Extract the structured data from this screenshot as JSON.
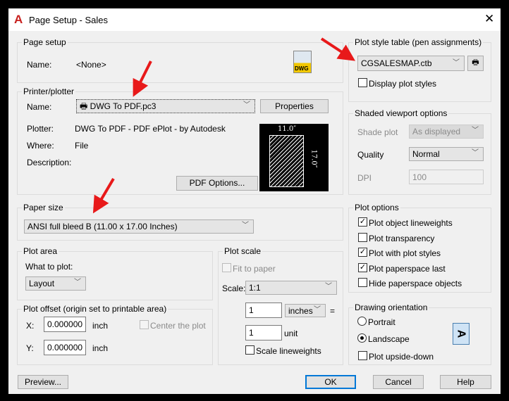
{
  "window": {
    "title": "Page Setup - Sales",
    "close_icon": "close-icon"
  },
  "page_setup": {
    "legend": "Page setup",
    "name_label": "Name:",
    "name_value": "<None>"
  },
  "printer": {
    "legend": "Printer/plotter",
    "name_label": "Name:",
    "name_value": "DWG To PDF.pc3",
    "properties": "Properties",
    "plotter_label": "Plotter:",
    "plotter_value": "DWG To PDF - PDF ePlot - by Autodesk",
    "where_label": "Where:",
    "where_value": "File",
    "description_label": "Description:",
    "pdf_options": "PDF Options...",
    "preview_width": "11.0″",
    "preview_height": "17.0″"
  },
  "paper_size": {
    "legend": "Paper size",
    "value": "ANSI full bleed B (11.00 x 17.00 Inches)"
  },
  "plot_area": {
    "legend": "Plot area",
    "what_label": "What to plot:",
    "what_value": "Layout"
  },
  "plot_offset": {
    "legend": "Plot offset (origin set to printable area)",
    "x_label": "X:",
    "x_value": "0.000000",
    "y_label": "Y:",
    "y_value": "0.000000",
    "unit": "inch",
    "center": "Center the plot"
  },
  "plot_scale": {
    "legend": "Plot scale",
    "fit": "Fit to paper",
    "scale_label": "Scale:",
    "scale_value": "1:1",
    "inches_value": "1",
    "inches_unit": "inches",
    "equals": "=",
    "unit_value": "1",
    "unit_label": "unit",
    "scale_lineweights": "Scale lineweights"
  },
  "plot_style": {
    "legend": "Plot style table (pen assignments)",
    "value": "CGSALESMAP.ctb",
    "display": "Display plot styles"
  },
  "shaded": {
    "legend": "Shaded viewport options",
    "shade_label": "Shade plot",
    "shade_value": "As displayed",
    "quality_label": "Quality",
    "quality_value": "Normal",
    "dpi_label": "DPI",
    "dpi_value": "100"
  },
  "plot_options": {
    "legend": "Plot options",
    "items": [
      {
        "label": "Plot object lineweights",
        "checked": true
      },
      {
        "label": "Plot transparency",
        "checked": false
      },
      {
        "label": "Plot with plot styles",
        "checked": true
      },
      {
        "label": "Plot paperspace last",
        "checked": true
      },
      {
        "label": "Hide paperspace objects",
        "checked": false
      }
    ]
  },
  "orientation": {
    "legend": "Drawing orientation",
    "portrait": "Portrait",
    "landscape": "Landscape",
    "selected": "Landscape",
    "upside_down": "Plot upside-down",
    "icon_letter": "A"
  },
  "buttons": {
    "preview": "Preview...",
    "ok": "OK",
    "cancel": "Cancel",
    "help": "Help"
  },
  "colors": {
    "accent": "#0078d7",
    "arrow": "#e8191a"
  }
}
